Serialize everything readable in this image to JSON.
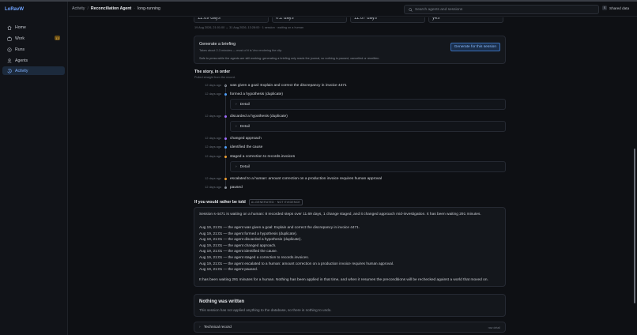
{
  "app": {
    "brand": "LoRavW"
  },
  "sidebar": {
    "items": [
      {
        "label": "Home",
        "icon": "home-icon"
      },
      {
        "label": "Work",
        "icon": "briefcase-icon",
        "badge": "13"
      },
      {
        "label": "Runs",
        "icon": "runs-icon"
      },
      {
        "label": "Agents",
        "icon": "person-icon"
      },
      {
        "label": "Activity",
        "icon": "activity-icon",
        "active": true
      }
    ]
  },
  "header": {
    "breadcrumb_root": "Activity",
    "breadcrumb_sep": "/",
    "breadcrumb_current": "Reconciliation Agent",
    "breadcrumb_dot": "·",
    "breadcrumb_mode": "long-running",
    "search_placeholder": "Search agents and sessions",
    "shared_key": "S",
    "shared_label": "Shared data"
  },
  "stats": [
    "11.69 days",
    "0.2 days",
    "11.67 days",
    "yes"
  ],
  "meta_line": "19 Aug 2026, 21:01:00 → 31 Aug 2026, 13:28:00 · 1 session · waiting on a human",
  "briefing": {
    "title": "Generate a briefing",
    "subtitle": "Takes about 2-3 minutes — most of it is Veo rendering the clip.",
    "note": "Safe to press while the agents are still working: generating a briefing only reads the journal, so nothing is paused, cancelled or rewritten.",
    "button": "Generate for this session"
  },
  "story": {
    "title": "The story, in order",
    "subtitle": "Pulled straight from the record.",
    "events": [
      {
        "time": "12 days ago",
        "text": "was given a goal: Explain and correct the discrepancy in invoice 4471",
        "color": "#8a9099",
        "hollow": true
      },
      {
        "time": "12 days ago",
        "text": "formed a hypothesis (duplicate)",
        "color": "#4ea1ff"
      },
      {
        "time": "12 days ago",
        "text": "discarded a hypothesis (duplicate)",
        "color": "#a06bff"
      },
      {
        "time": "12 days ago",
        "text": "changed approach",
        "color": "#a06bff"
      },
      {
        "time": "12 days ago",
        "text": "identified the cause",
        "color": "#4ea1ff"
      },
      {
        "time": "12 days ago",
        "text": "staged a correction to records.invoices",
        "color": "#f0a030"
      },
      {
        "time": "12 days ago",
        "text": "escalated to a human: amount correction on a production invoice requires human approval",
        "color": "#f0a030"
      },
      {
        "time": "12 days ago",
        "text": "paused",
        "color": "#8a9099"
      }
    ],
    "detail_label": "Detail",
    "detail_chevron": "›"
  },
  "told": {
    "title": "If you would rather be told",
    "tag": "AI-GENERATED · NOT EVIDENCE",
    "summary": "Session s-4471 is waiting on a human: 8 recorded steps over 11.69 days, 1 change staged, and it changed approach mid-investigation. It has been waiting 291 minutes.",
    "log": [
      "Aug 19, 21:01 — the agent was given a goal: Explain and correct the discrepancy in invoice 4471.",
      "Aug 19, 21:01 — the agent formed a hypothesis (duplicate).",
      "Aug 19, 21:01 — the agent discarded a hypothesis (duplicate).",
      "Aug 19, 21:01 — the agent changed approach.",
      "Aug 19, 21:01 — the agent identified the cause.",
      "Aug 19, 21:01 — the agent staged a correction to records.invoices.",
      "Aug 19, 21:01 — the agent escalated to a human: amount correction on a production invoice requires human approval.",
      "Aug 19, 21:01 — the agent paused."
    ],
    "footer": "It has been waiting 291 minutes for a human. Nothing has been applied in that time, and when it resumes the preconditions will be rechecked against a world that moved on."
  },
  "nothing": {
    "title": "Nothing was written",
    "subtitle": "This session has not applied anything to the database, so there is nothing to undo."
  },
  "technical": {
    "label": "Technical record",
    "chevron": "›",
    "right": "raw detail"
  }
}
